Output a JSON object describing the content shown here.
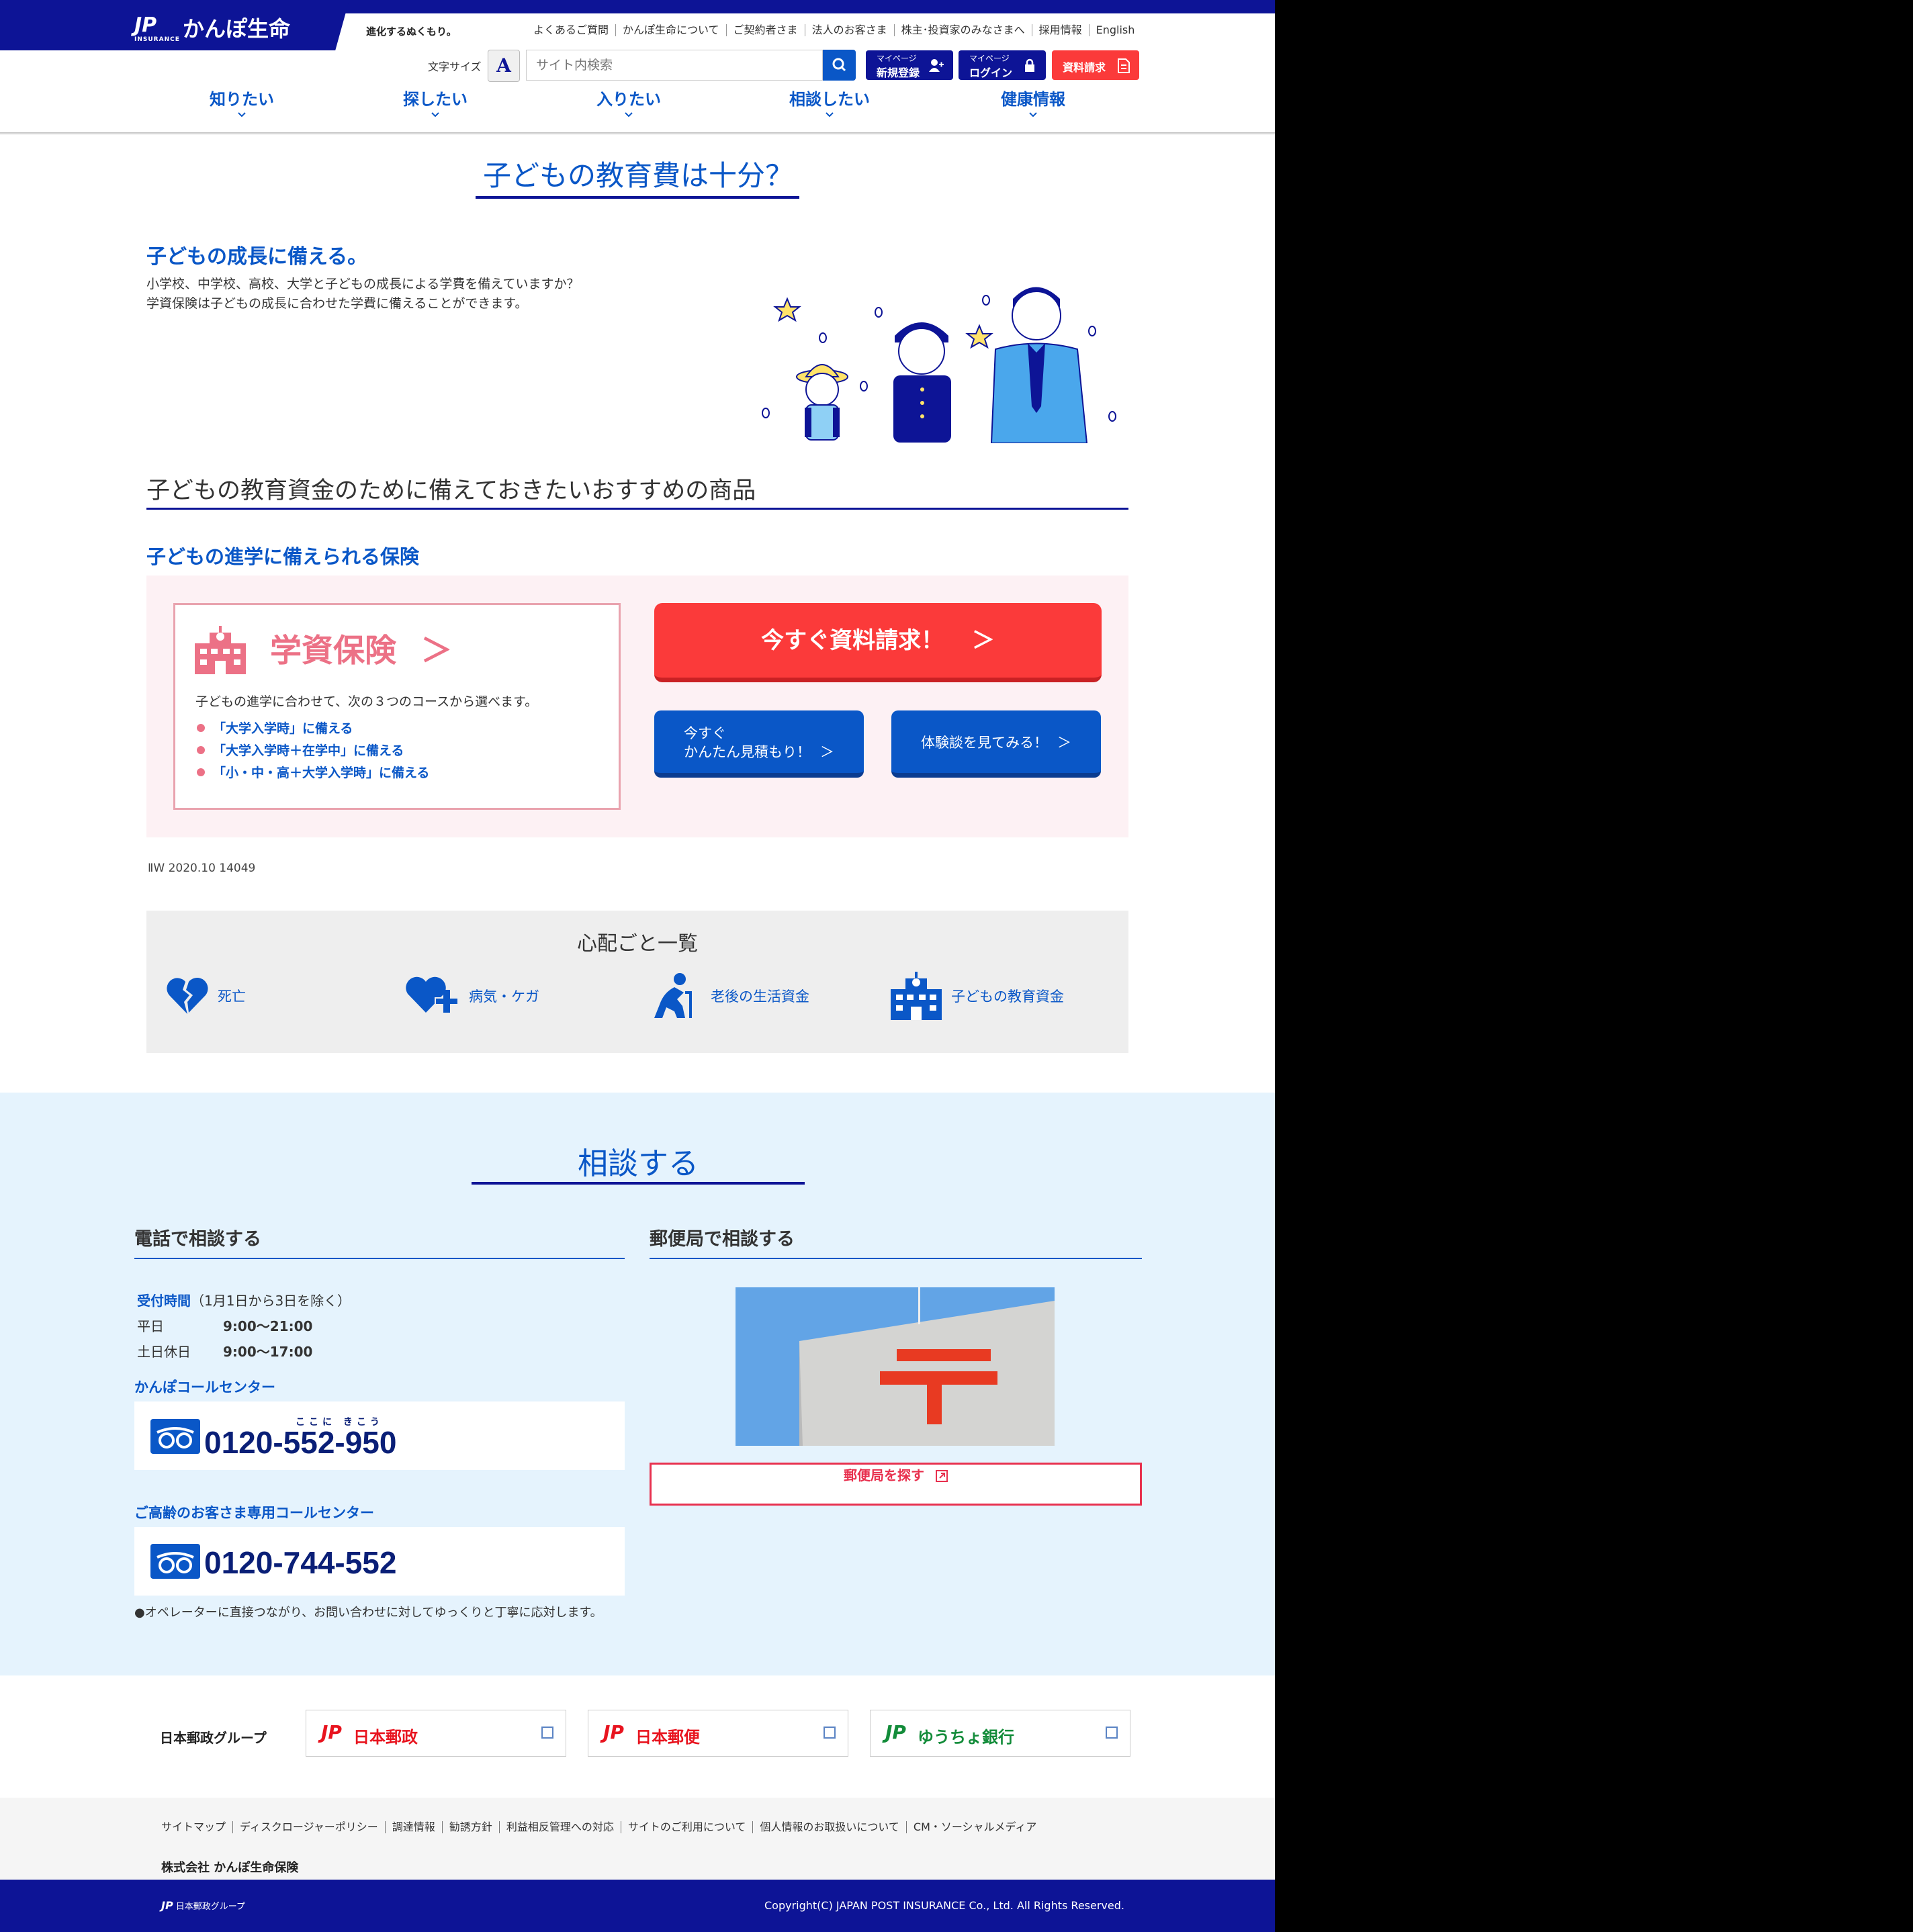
{
  "header": {
    "logo_mark": "JP",
    "logo_mark_sub": "INSURANCE",
    "logo_text": "かんぽ生命",
    "tagline": "進化するぬくもり。",
    "utility_links": [
      "よくあるご質問",
      "かんぽ生命について",
      "ご契約者さま",
      "法人のお客さま",
      "株主･投資家のみなさまへ",
      "採用情報",
      "English"
    ],
    "font_size_label": "文字サイズ",
    "font_size_icon": "A",
    "search_placeholder": "サイト内検索",
    "register": {
      "small": "マイページ",
      "label": "新規登録"
    },
    "login": {
      "small": "マイページ",
      "label": "ログイン"
    },
    "request_docs": "資料請求"
  },
  "main_nav": [
    "知りたい",
    "探したい",
    "入りたい",
    "相談したい",
    "健康情報"
  ],
  "page_title": "子どもの教育費は十分？",
  "intro": {
    "heading": "子どもの成長に備える。",
    "line1": "小学校、中学校、高校、大学と子どもの成長による学費を備えていますか？",
    "line2": "学資保険は子どもの成長に合わせた学費に備えることができます。"
  },
  "recommend_heading": "子どもの教育資金のために備えておきたいおすすめの商品",
  "product_section_heading": "子どもの進学に備えられる保険",
  "product": {
    "title": "学資保険",
    "arrow": "＞",
    "description": "子どもの進学に合わせて、次の３つのコースから選べます。",
    "courses": [
      "「大学入学時」に備える",
      "「大学入学時＋在学中」に備える",
      "「小・中・高＋大学入学時」に備える"
    ]
  },
  "cta": {
    "request_now": "今すぐ資料請求！",
    "request_arrow": "＞",
    "estimate_line1": "今すぐ",
    "estimate_line2": "かんたん見積もり！",
    "experience": "体験談を見てみる！",
    "arrow": "＞"
  },
  "doc_code": "ⅡW 2020.10 14049",
  "worries": {
    "title": "心配ごと一覧",
    "items": [
      "死亡",
      "病気・ケガ",
      "老後の生活資金",
      "子どもの教育資金"
    ]
  },
  "consult": {
    "title": "相談する",
    "phone_heading": "電話で相談する",
    "post_heading": "郵便局で相談する",
    "hours_label": "受付時間",
    "hours_note": "（1月1日から3日を除く）",
    "weekday_label": "平日",
    "weekday_hours": "9:00～21:00",
    "weekend_label": "土日休日",
    "weekend_hours": "9:00～17:00",
    "center1_label": "かんぽコールセンター",
    "center1_number": "0120-552-950",
    "center1_ruby": "ここに きこう",
    "center2_label": "ご高齢のお客さま専用コールセンター",
    "center2_number": "0120-744-552",
    "note": "●オペレーターに直接つながり、お問い合わせに対してゆっくりと丁寧に応対します。",
    "find_post_office": "郵便局を探す"
  },
  "group": {
    "label": "日本郵政グループ",
    "companies": [
      {
        "name": "日本郵政",
        "color": "#e8141f"
      },
      {
        "name": "日本郵便",
        "color": "#e8141f"
      },
      {
        "name": "ゆうちょ銀行",
        "color": "#138c3a"
      }
    ]
  },
  "footer": {
    "links": [
      "サイトマップ",
      "ディスクロージャーポリシー",
      "調達情報",
      "勧誘方針",
      "利益相反管理への対応",
      "サイトのご利用について",
      "個人情報のお取扱いについて",
      "CM・ソーシャルメディア"
    ],
    "company": "株式会社 かんぽ生命保険",
    "group_logo": "日本郵政グループ",
    "copyright": "Copyright(C) JAPAN POST INSURANCE Co., Ltd. All Rights Reserved."
  },
  "colors": {
    "brand_navy": "#0d1496",
    "link_blue": "#0a57c7",
    "cta_red": "#fb3a3a",
    "product_pink": "#ec7186",
    "consult_bg": "#e5f3fd"
  }
}
